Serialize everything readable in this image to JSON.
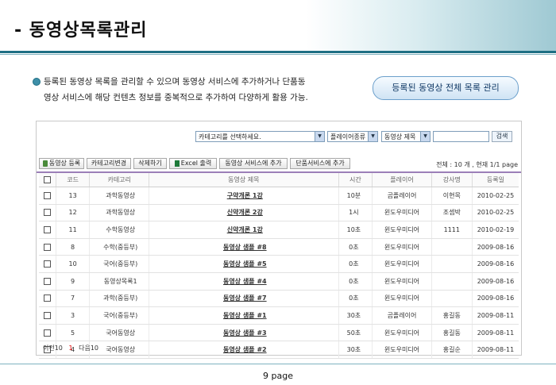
{
  "page_title": "- 동영상목록관리",
  "description": {
    "line1": "등록된 동영상 목록을 관리할 수 있으며 동영상 서비스에 추가하거나 단품동",
    "line2": "영상 서비스에 해당 컨텐츠 정보를 중복적으로 추가하여 다양하게 활용 가능."
  },
  "manage_button": "등록된 동영상 전체 목록 관리",
  "search": {
    "category_select": "카테고리를 선택하세요.",
    "player_select": "플레이어종류",
    "field_select": "동영상 제목",
    "search_button": "검색"
  },
  "toolbar": {
    "register": "동영상 등록",
    "category_change": "카테고리변경",
    "delete": "삭제하기",
    "excel": "Excel 출력",
    "add_service": "동영상 서비스에 추가",
    "add_single": "단품서비스에 추가"
  },
  "summary": "전체 : 10 개 , 현재 1/1 page",
  "columns": [
    "코드",
    "카테고리",
    "동영상 제목",
    "시간",
    "플레이어",
    "강사명",
    "등록일"
  ],
  "rows": [
    {
      "code": "13",
      "category": "과학동영상",
      "title": "구약개론 1강",
      "time": "10분",
      "player": "곰플레이어",
      "teacher": "이현목",
      "date": "2010-02-25"
    },
    {
      "code": "12",
      "category": "과학동영상",
      "title": "신약개론 2강",
      "time": "1시",
      "player": "윈도우미디어",
      "teacher": "조셉박",
      "date": "2010-02-25"
    },
    {
      "code": "11",
      "category": "수학동영상",
      "title": "신약개론 1강",
      "time": "10초",
      "player": "윈도우미디어",
      "teacher": "1111",
      "date": "2010-02-19"
    },
    {
      "code": "8",
      "category": "수학(중등부)",
      "title": "동영상 샘플 #8",
      "time": "0초",
      "player": "윈도우미디어",
      "teacher": "",
      "date": "2009-08-16"
    },
    {
      "code": "10",
      "category": "국어(중등부)",
      "title": "동영상 샘플 #5",
      "time": "0초",
      "player": "윈도우미디어",
      "teacher": "",
      "date": "2009-08-16"
    },
    {
      "code": "9",
      "category": "동영상목록1",
      "title": "동영상 샘플 #4",
      "time": "0초",
      "player": "윈도우미디어",
      "teacher": "",
      "date": "2009-08-16"
    },
    {
      "code": "7",
      "category": "과학(중등부)",
      "title": "동영상 샘플 #7",
      "time": "0초",
      "player": "윈도우미디어",
      "teacher": "",
      "date": "2009-08-16"
    },
    {
      "code": "3",
      "category": "국어(중등부)",
      "title": "동영상 샘플 #1",
      "time": "30초",
      "player": "곰플레이어",
      "teacher": "홍길동",
      "date": "2009-08-11"
    },
    {
      "code": "5",
      "category": "국어동영상",
      "title": "동영상 샘플 #3",
      "time": "50초",
      "player": "윈도우미디어",
      "teacher": "홍길동",
      "date": "2009-08-11"
    },
    {
      "code": "4",
      "category": "국어동영상",
      "title": "동영상 샘플 #2",
      "time": "30초",
      "player": "윈도우미디어",
      "teacher": "홍길순",
      "date": "2009-08-11"
    }
  ],
  "pager": {
    "prev": "이전10",
    "current": "1",
    "next": "다음10"
  },
  "footer": "9 page"
}
